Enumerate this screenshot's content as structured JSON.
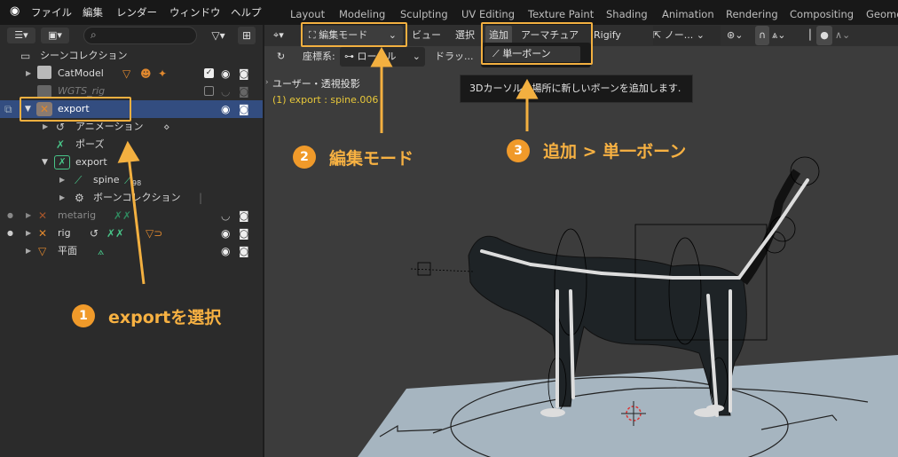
{
  "menubar": {
    "items": [
      "ファイル",
      "編集",
      "レンダー",
      "ウィンドウ",
      "ヘルプ"
    ],
    "workspaces": [
      "Layout",
      "Modeling",
      "Sculpting",
      "UV Editing",
      "Texture Paint",
      "Shading",
      "Animation",
      "Rendering",
      "Compositing",
      "Geome"
    ]
  },
  "outliner": {
    "rows": [
      {
        "label": "シーンコレクション"
      },
      {
        "label": "CatModel"
      },
      {
        "label": "WGTS_rig"
      },
      {
        "label": "export"
      },
      {
        "label": "アニメーション"
      },
      {
        "label": "ポーズ"
      },
      {
        "label": "export"
      },
      {
        "label": "spine",
        "badge": "98"
      },
      {
        "label": "ボーンコレクション"
      },
      {
        "label": "metarig"
      },
      {
        "label": "rig"
      },
      {
        "label": "平面"
      }
    ]
  },
  "viewport": {
    "mode_label": "編集モード",
    "view": "ビュー",
    "select": "選択",
    "add": "追加",
    "armature": "アーマチュア",
    "rigify": "Rigify",
    "orientation_label": "座標系:",
    "orientation_value": "ローカル",
    "drag_label": "ドラッ...",
    "pivot": "ノー...",
    "view_name": "ユーザー・透視投影",
    "object_info": "(1) export : spine.006",
    "dropdown_item": "単一ボーン",
    "tooltip": "3Dカーソルの場所に新しいボーンを追加します."
  },
  "annotations": {
    "step1": "exportを選択",
    "step2": "編集モード",
    "step3": "追加 > 単一ボーン",
    "n1": "1",
    "n2": "2",
    "n3": "3"
  },
  "colors": {
    "accent": "#f3b040",
    "selection": "#334d80",
    "circle": "#f09a2a"
  }
}
